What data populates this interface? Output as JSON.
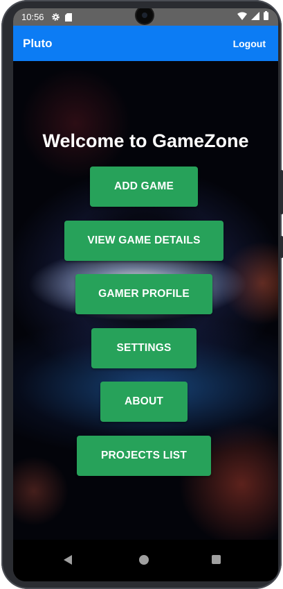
{
  "status_bar": {
    "time": "10:56",
    "left_icons": [
      "gear-icon",
      "sd-card-icon"
    ],
    "right_icons": [
      "wifi-icon",
      "cellular-signal-icon",
      "battery-icon"
    ]
  },
  "app_bar": {
    "title": "Pluto",
    "logout_label": "Logout",
    "color": "#0c7cf4"
  },
  "main": {
    "welcome_text": "Welcome to GameZone",
    "button_color": "#27a25a",
    "buttons": [
      {
        "label": "ADD GAME"
      },
      {
        "label": "VIEW GAME DETAILS"
      },
      {
        "label": "GAMER PROFILE"
      },
      {
        "label": "SETTINGS"
      },
      {
        "label": "ABOUT"
      },
      {
        "label": "PROJECTS LIST"
      }
    ]
  },
  "nav_bar": {
    "icons": [
      "back-icon",
      "home-icon",
      "recents-icon"
    ]
  }
}
